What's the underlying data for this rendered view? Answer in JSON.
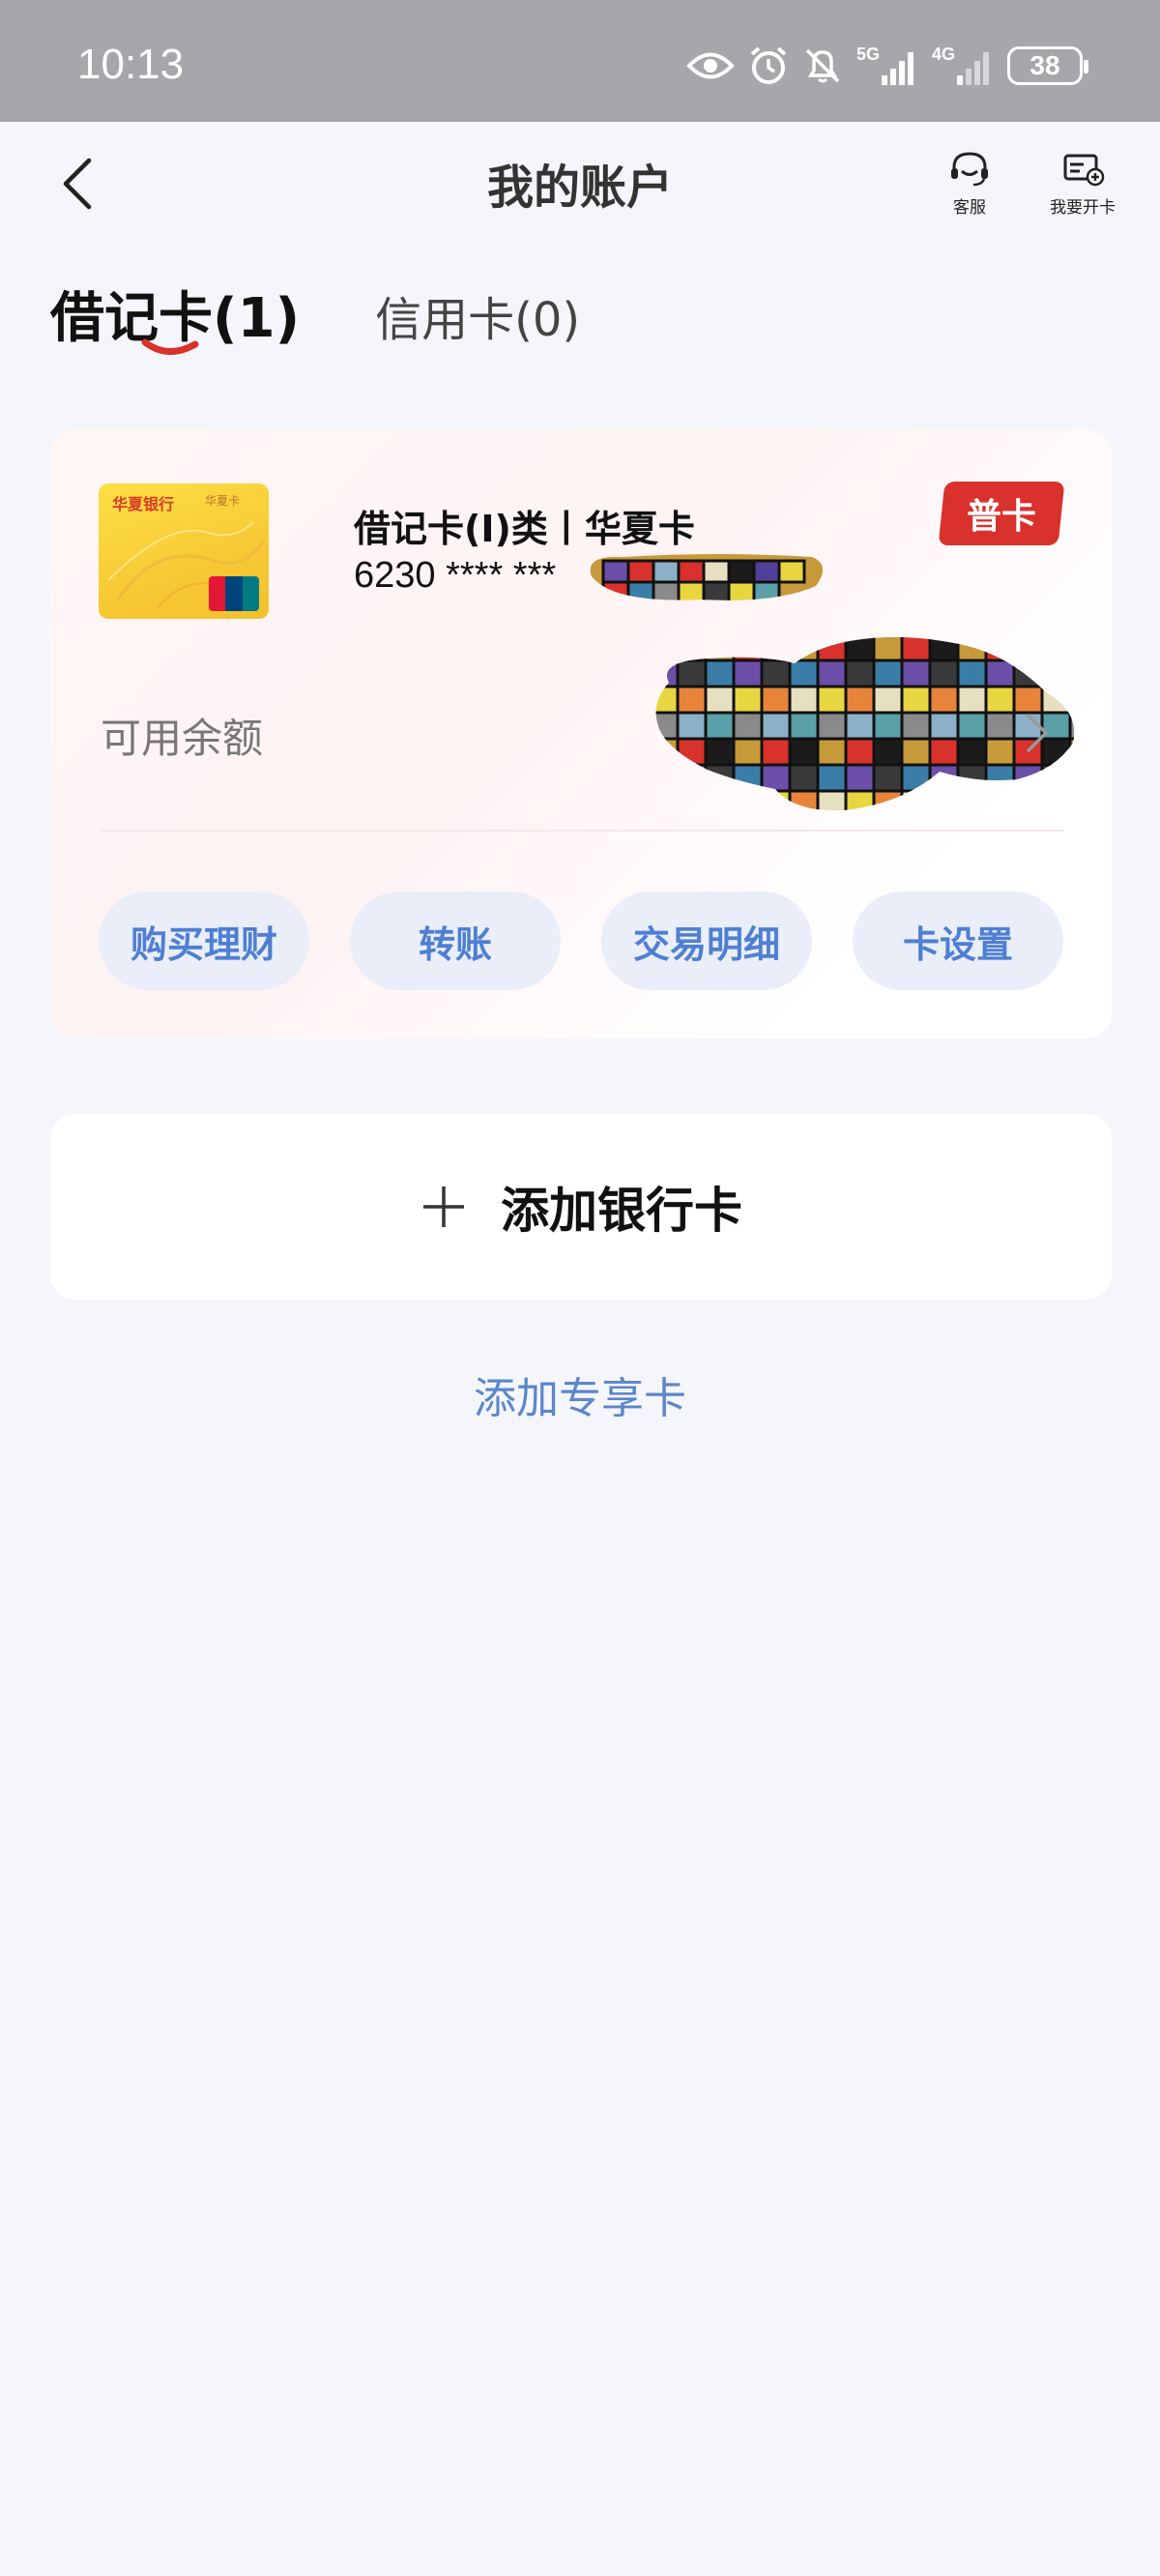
{
  "status_bar": {
    "time": "10:13",
    "network_1": "5G",
    "network_2": "4G",
    "battery": "38"
  },
  "header": {
    "title": "我的账户",
    "service_label": "客服",
    "open_card_label": "我要开卡"
  },
  "tabs": {
    "debit": "借记卡(1)",
    "credit": "信用卡(0)"
  },
  "card": {
    "thumb_logo": "华夏银行",
    "thumb_sub": "华夏卡",
    "name": "借记卡(I)类丨华夏卡",
    "number_masked": "6230 **** ***",
    "badge": "普卡",
    "balance_label": "可用余额",
    "actions": [
      "购买理财",
      "转账",
      "交易明细",
      "卡设置"
    ]
  },
  "add_bank_card": "添加银行卡",
  "add_exclusive_card": "添加专享卡",
  "colors": {
    "status_bar_bg": "#a6a7ab",
    "page_bg": "#f5f6fb",
    "accent_blue": "#4f7fd2",
    "badge_red": "#d9312b",
    "action_bg": "#e9eef9"
  }
}
